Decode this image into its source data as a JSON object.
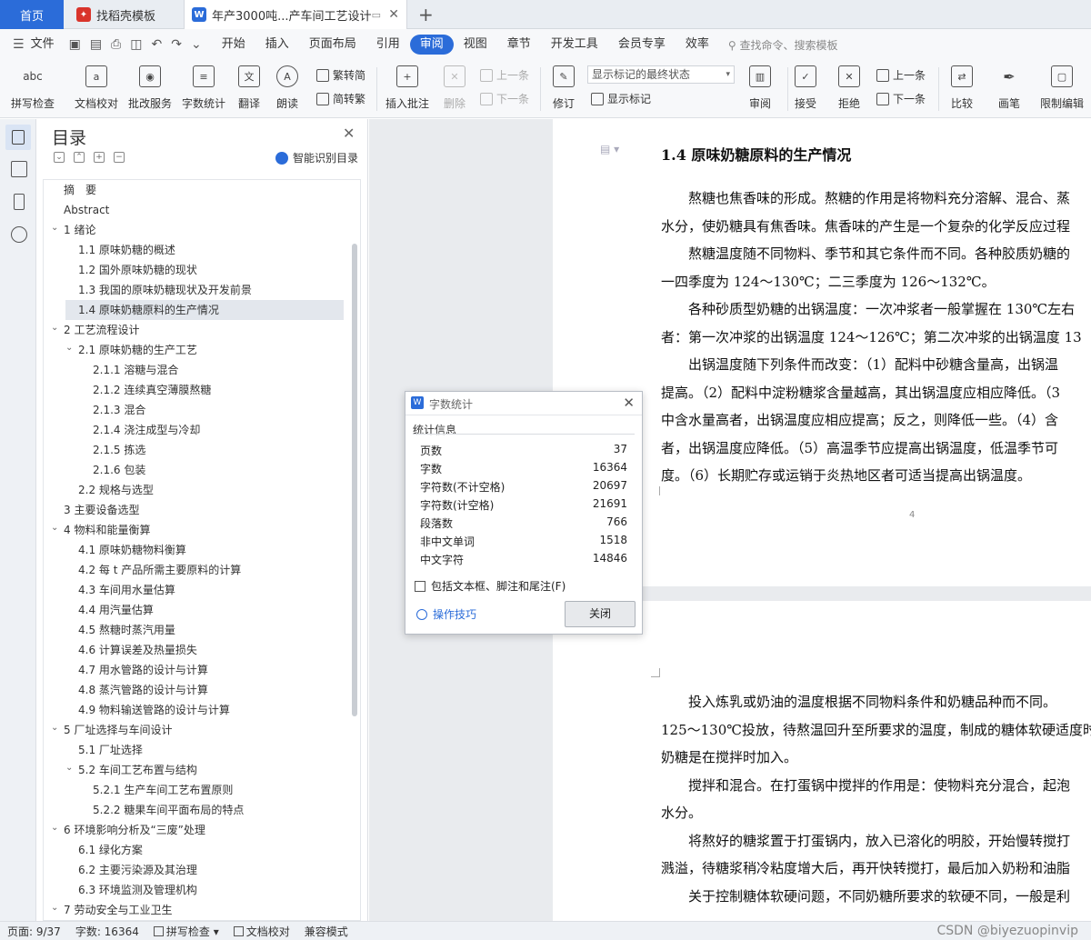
{
  "tabs": {
    "home": "首页",
    "docer": "找稻壳模板",
    "doc": "年产3000吨...产车间工艺设计"
  },
  "menu": {
    "file": "文件",
    "items": [
      "开始",
      "插入",
      "页面布局",
      "引用",
      "审阅",
      "视图",
      "章节",
      "开发工具",
      "会员专享",
      "效率"
    ],
    "active": "审阅",
    "search": "查找命令、搜索模板"
  },
  "ribbon": {
    "spellcheck": "拼写检查",
    "doc_proof": "文档校对",
    "batch_annot": "批改服务",
    "word_count": "字数统计",
    "translate": "翻译",
    "read_aloud": "朗读",
    "to_trad": "繁转简",
    "to_simp": "简转繁",
    "insert_comment": "插入批注",
    "delete": "删除",
    "prev_comment": "上一条",
    "next_comment": "下一条",
    "revise": "修订",
    "markup_state": "显示标记的最终状态",
    "show_markup": "显示标记",
    "review": "审阅",
    "accept": "接受",
    "reject": "拒绝",
    "prev_change": "上一条",
    "next_change": "下一条",
    "compare": "比较",
    "ink": "画笔",
    "restrict": "限制编辑"
  },
  "toc": {
    "title": "目录",
    "smart": "智能识别目录",
    "items": [
      "摘　要",
      "Abstract",
      "1 绪论",
      "1.1 原味奶糖的概述",
      "1.2 国外原味奶糖的现状",
      "1.3 我国的原味奶糖现状及开发前景",
      "1.4 原味奶糖原料的生产情况",
      "2 工艺流程设计",
      "2.1  原味奶糖的生产工艺",
      "2.1.1  溶糖与混合",
      "2.1.2  连续真空薄膜熬糖",
      "2.1.3  混合",
      "2.1.4  浇注成型与冷却",
      "2.1.5 拣选",
      "2.1.6 包装",
      "2.2 规格与选型",
      "3 主要设备选型",
      "4 物料和能量衡算",
      "4.1  原味奶糖物料衡算",
      "4.2  每 t 产品所需主要原料的计算",
      "4.3  车间用水量估算",
      "4.4 用汽量估算",
      "4.5 熬糖时蒸汽用量",
      "4.6 计算误差及热量损失",
      "4.7 用水管路的设计与计算",
      "4.8 蒸汽管路的设计与计算",
      "4.9 物料输送管路的设计与计算",
      "5 厂址选择与车间设计",
      "5.1 厂址选择",
      "5.2 车间工艺布置与结构",
      "5.2.1 生产车间工艺布置原则",
      "5.2.2 糖果车间平面布局的特点",
      "6 环境影响分析及“三废”处理",
      "6.1 绿化方案",
      "6.2 主要污染源及其治理",
      "6.3 环境监测及管理机构",
      "7 劳动安全与工业卫生"
    ]
  },
  "document": {
    "heading": "1.4 原味奶糖原料的生产情况",
    "page1_lines": [
      "　　熬糖也焦香味的形成。熬糖的作用是将物料充分溶解、混合、蒸",
      "水分，使奶糖具有焦香味。焦香味的产生是一个复杂的化学反应过程",
      "　　熬糖温度随不同物料、季节和其它条件而不同。各种胶质奶糖的",
      "一四季度为 124～130℃；二三季度为 126～132℃。",
      "　　各种砂质型奶糖的出锅温度：一次冲浆者一般掌握在 130℃左右",
      "者：第一次冲浆的出锅温度 124～126℃；第二次冲浆的出锅温度 13",
      "　　出锅温度随下列条件而改变：（1）配料中砂糖含量高，出锅温",
      "提高。（2）配料中淀粉糖浆含量越高，其出锅温度应相应降低。（3",
      "中含水量高者，出锅温度应相应提高；反之，则降低一些。（4）含",
      "者，出锅温度应降低。（5）高温季节应提高出锅温度，低温季节可",
      "度。（6）长期贮存或运销于炎热地区者可适当提高出锅温度。"
    ],
    "page_number": "4",
    "page2_lines": [
      "　　投入炼乳或奶油的温度根据不同物料条件和奶糖品种而不同。",
      "125～130℃投放，待熬温回升至所要求的温度，制成的糖体软硬适度时",
      "奶糖是在搅拌时加入。",
      "　　搅拌和混合。在打蛋锅中搅拌的作用是：使物料充分混合，起泡",
      "水分。",
      "　　将熬好的糖浆置于打蛋锅内，放入已溶化的明胶，开始慢转搅打",
      "溅溢，待糖浆稍冷粘度增大后，再开快转搅打，最后加入奶粉和油脂",
      "　　关于控制糖体软硬问题，不同奶糖所要求的软硬不同，一般是利"
    ]
  },
  "dialog": {
    "title": "字数统计",
    "section": "统计信息",
    "stats": [
      {
        "label": "页数",
        "value": "37"
      },
      {
        "label": "字数",
        "value": "16364"
      },
      {
        "label": "字符数(不计空格)",
        "value": "20697"
      },
      {
        "label": "字符数(计空格)",
        "value": "21691"
      },
      {
        "label": "段落数",
        "value": "766"
      },
      {
        "label": "非中文单词",
        "value": "1518"
      },
      {
        "label": "中文字符",
        "value": "14846"
      }
    ],
    "include_label": "包括文本框、脚注和尾注(F)",
    "tips": "操作技巧",
    "close": "关闭"
  },
  "status": {
    "page": "页面: 9/37",
    "words": "字数: 16364",
    "spell": "拼写检查",
    "proof": "文档校对",
    "compat": "兼容模式"
  },
  "watermark": "CSDN @biyezuopinvip",
  "colors": {
    "accent": "#2b6cd9"
  }
}
